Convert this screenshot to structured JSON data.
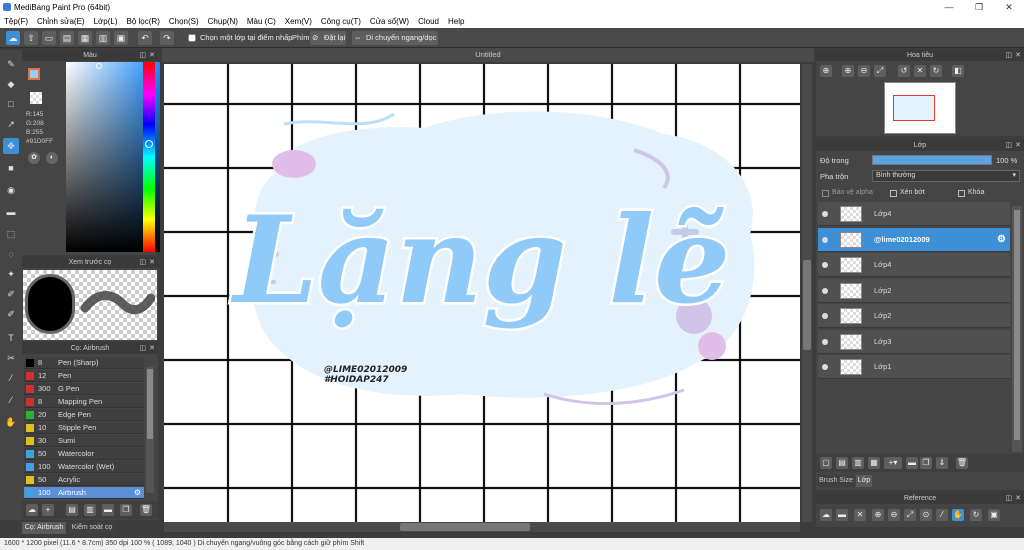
{
  "window": {
    "title": "MediBang Paint Pro (64bit)",
    "minimize": "—",
    "restore": "❐",
    "close": "✕"
  },
  "menu": [
    "Tệp(F)",
    "Chỉnh sửa(E)",
    "Lớp(L)",
    "Bộ lọc(R)",
    "Chọn(S)",
    "Chụp(N)",
    "Màu (C)",
    "Xem(V)",
    "Công cụ(T)",
    "Cửa sổ(W)",
    "Cloud",
    "Help"
  ],
  "toolbar": {
    "select_from_point": "Chọn một lớp tại điểm nhấp",
    "snap_label": "Phím",
    "reset": "Đặt lại",
    "move_hv": "Di chuyển ngang/dọc"
  },
  "color_panel": {
    "title": "Màu",
    "r": "R:145",
    "g": "G:208",
    "b": "B:255",
    "hex": "#91D0FF",
    "fg_color": "#91d0ff",
    "accent": "#1d8eff"
  },
  "preview_panel": {
    "title": "Xem trước cọ"
  },
  "brush_panel": {
    "title": "Cọ: Airbrush",
    "brushes": [
      {
        "size": "8",
        "name": "Pen (Sharp)",
        "color": "#000000"
      },
      {
        "size": "12",
        "name": "Pen",
        "color": "#d03030"
      },
      {
        "size": "300",
        "name": "G Pen",
        "color": "#d03030"
      },
      {
        "size": "8",
        "name": "Mapping Pen",
        "color": "#d03030"
      },
      {
        "size": "20",
        "name": "Edge Pen",
        "color": "#30b030"
      },
      {
        "size": "10",
        "name": "Stipple Pen",
        "color": "#e0c020"
      },
      {
        "size": "30",
        "name": "Sumi",
        "color": "#e0c020"
      },
      {
        "size": "50",
        "name": "Watercolor",
        "color": "#40a0e0"
      },
      {
        "size": "100",
        "name": "Watercolor (Wet)",
        "color": "#40a0e0"
      },
      {
        "size": "50",
        "name": "Acrylic",
        "color": "#e0c020"
      },
      {
        "size": "100",
        "name": "Airbrush",
        "color": "#40a0e0"
      }
    ],
    "tab1": "Cọ: Airbrush",
    "tab2": "Kiểm soát cọ"
  },
  "canvas": {
    "title": "Untitled",
    "art_text": "Lặng lẽ",
    "credit1": "@LIME02012009",
    "credit2": "#HOIDAP247"
  },
  "navigator": {
    "title": "Hoa tiêu"
  },
  "layer_panel": {
    "title": "Lớp",
    "opacity_label": "Độ trong",
    "opacity_value": "100 %",
    "blend_label": "Pha trộn",
    "blend_value": "Bình thường",
    "protect_alpha": "Bảo vệ alpha",
    "clip": "Xén bớt",
    "lock": "Khóa",
    "layers": [
      {
        "name": "Lớp4",
        "selected": false
      },
      {
        "name": "@lime02012009",
        "selected": true
      },
      {
        "name": "Lớp4",
        "selected": false
      },
      {
        "name": "Lớp2",
        "selected": false
      },
      {
        "name": "Lớp2",
        "selected": false
      },
      {
        "name": "Lớp3",
        "selected": false
      },
      {
        "name": "Lớp1",
        "selected": false
      }
    ],
    "tab_brush_size": "Brush Size",
    "tab_layer": "Lớp"
  },
  "reference": {
    "title": "Reference"
  },
  "status": "1600 * 1200 pixel   (11.6 * 8.7cm)  350 dpi  100 %   ( 1089, 1040 )  Di chuyển ngang/vuông góc bằng cách giữ phím Shift"
}
